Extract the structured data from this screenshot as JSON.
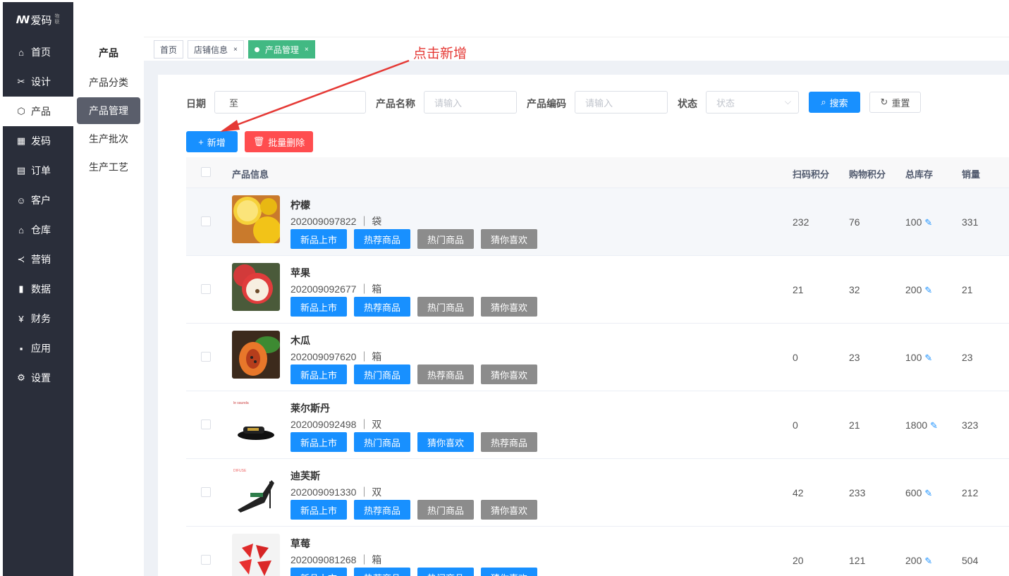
{
  "logo": {
    "text": "爱码",
    "sub": "物联"
  },
  "nav": [
    {
      "label": "首页",
      "icon": "home-icon"
    },
    {
      "label": "设计",
      "icon": "design-icon"
    },
    {
      "label": "产品",
      "icon": "cube-icon"
    },
    {
      "label": "发码",
      "icon": "qrcode-icon"
    },
    {
      "label": "订单",
      "icon": "order-icon"
    },
    {
      "label": "客户",
      "icon": "user-icon"
    },
    {
      "label": "仓库",
      "icon": "warehouse-icon"
    },
    {
      "label": "营销",
      "icon": "share-icon"
    },
    {
      "label": "数据",
      "icon": "chart-icon"
    },
    {
      "label": "财务",
      "icon": "yen-icon"
    },
    {
      "label": "应用",
      "icon": "grid-icon"
    },
    {
      "label": "设置",
      "icon": "gear-icon"
    }
  ],
  "subnav": {
    "title": "产品",
    "items": [
      "产品分类",
      "产品管理",
      "生产批次",
      "生产工艺"
    ]
  },
  "tabs": [
    {
      "label": "首页"
    },
    {
      "label": "店铺信息",
      "close": "×"
    },
    {
      "label": "产品管理",
      "close": "×"
    }
  ],
  "filters": {
    "date_label": "日期",
    "date_sep": "至",
    "name_label": "产品名称",
    "name_placeholder": "请输入",
    "code_label": "产品编码",
    "code_placeholder": "请输入",
    "status_label": "状态",
    "status_placeholder": "状态",
    "search": "搜索",
    "reset": "重置"
  },
  "actions": {
    "add": "新增",
    "batch_delete": "批量删除"
  },
  "annotation": "点击新增",
  "table": {
    "headers": [
      "产品信息",
      "扫码积分",
      "购物积分",
      "总库存",
      "销量"
    ],
    "rows": [
      {
        "name": "柠檬",
        "code": "202009097822 ｜ 袋",
        "tags": [
          "新品上市",
          "热荐商品",
          "热门商品",
          "猜你喜欢"
        ],
        "tag_colors": [
          "blue",
          "blue",
          "gray",
          "gray"
        ],
        "scan": "232",
        "shop": "76",
        "stock": "100",
        "sales": "331"
      },
      {
        "name": "苹果",
        "code": "202009092677 ｜ 箱",
        "tags": [
          "新品上市",
          "热荐商品",
          "热门商品",
          "猜你喜欢"
        ],
        "tag_colors": [
          "blue",
          "blue",
          "gray",
          "gray"
        ],
        "scan": "21",
        "shop": "32",
        "stock": "200",
        "sales": "21"
      },
      {
        "name": "木瓜",
        "code": "202009097620 ｜ 箱",
        "tags": [
          "新品上市",
          "热门商品",
          "热荐商品",
          "猜你喜欢"
        ],
        "tag_colors": [
          "blue",
          "blue",
          "gray",
          "gray"
        ],
        "scan": "0",
        "shop": "23",
        "stock": "100",
        "sales": "23"
      },
      {
        "name": "莱尔斯丹",
        "code": "202009092498 ｜ 双",
        "tags": [
          "新品上市",
          "热门商品",
          "猜你喜欢",
          "热荐商品"
        ],
        "tag_colors": [
          "blue",
          "blue",
          "blue",
          "gray"
        ],
        "scan": "0",
        "shop": "21",
        "stock": "1800",
        "sales": "323"
      },
      {
        "name": "迪芙斯",
        "code": "202009091330 ｜ 双",
        "tags": [
          "新品上市",
          "热荐商品",
          "热门商品",
          "猜你喜欢"
        ],
        "tag_colors": [
          "blue",
          "blue",
          "gray",
          "gray"
        ],
        "scan": "42",
        "shop": "233",
        "stock": "600",
        "sales": "212"
      },
      {
        "name": "草莓",
        "code": "202009081268 ｜ 箱",
        "tags": [
          "新品上市",
          "热荐商品",
          "热门商品",
          "猜你喜欢"
        ],
        "tag_colors": [
          "blue",
          "blue",
          "blue",
          "blue"
        ],
        "scan": "20",
        "shop": "121",
        "stock": "200",
        "sales": "504"
      }
    ]
  },
  "colors": {
    "primary": "#1890ff",
    "danger": "#ff4d4f",
    "nav_bg": "#2a2e3a",
    "tab_active": "#42b983",
    "annotation": "#e53935"
  }
}
